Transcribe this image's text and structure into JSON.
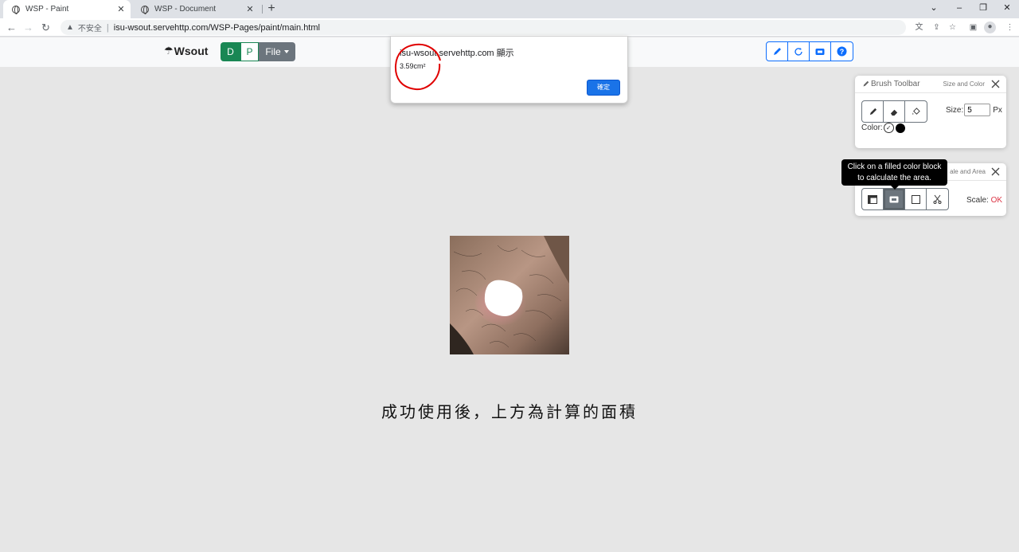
{
  "browser": {
    "tabs": [
      {
        "title": "WSP - Paint",
        "active": true
      },
      {
        "title": "WSP - Document",
        "active": false
      }
    ],
    "security_label": "不安全",
    "url": "isu-wsout.servehttp.com/WSP-Pages/paint/main.html"
  },
  "app": {
    "brand": "Wsout",
    "mode_buttons": {
      "d": "D",
      "p": "P"
    },
    "file_menu": "File"
  },
  "dialog": {
    "title": "isu-wsout.servehttp.com 顯示",
    "message": "3.59cm²",
    "ok_label": "確定"
  },
  "brush_panel": {
    "title": "Brush Toolbar",
    "subtitle": "Size and Color",
    "size_label": "Size:",
    "size_value": "5",
    "size_unit": "Px",
    "color_label": "Color:",
    "current_color": "#000000"
  },
  "area_panel": {
    "subtitle": "ale and Area",
    "scale_label": "Scale:",
    "scale_status": "OK"
  },
  "tooltip": {
    "line1": "Click on a filled color block",
    "line2": "to calculate the area."
  },
  "caption": "成功使用後，上方為計算的面積",
  "colors": {
    "primary": "#0d6efd",
    "success": "#198754",
    "secondary": "#6c757d",
    "danger": "#dc3545",
    "annotation": "#e00000"
  }
}
